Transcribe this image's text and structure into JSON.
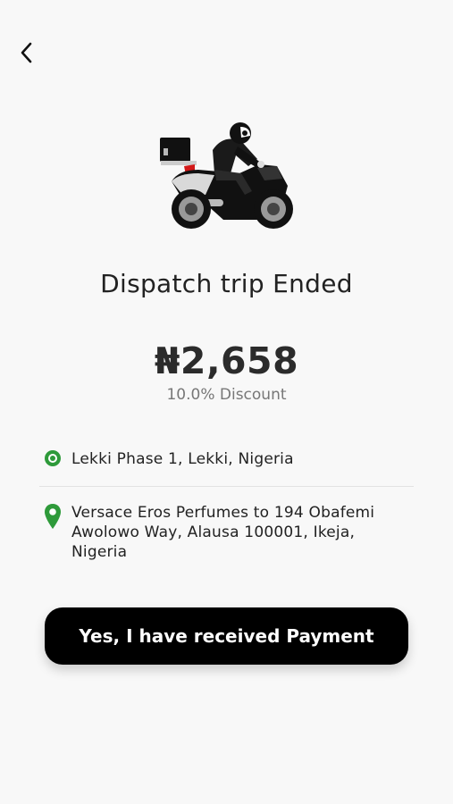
{
  "header": {
    "back_icon": "chevron-left-icon"
  },
  "hero": {
    "illustration": "dispatch-rider-illustration"
  },
  "trip": {
    "status_title": "Dispatch trip Ended",
    "amount": "₦2,658",
    "discount": "10.0% Discount"
  },
  "locations": {
    "pickup": {
      "icon": "pickup-dot-icon",
      "address": "Lekki Phase 1, Lekki, Nigeria"
    },
    "dropoff": {
      "icon": "map-pin-icon",
      "address": "Versace Eros Perfumes to 194 Obafemi Awolowo Way, Alausa 100001, Ikeja, Nigeria"
    }
  },
  "actions": {
    "confirm_label": "Yes, I have received Payment"
  },
  "colors": {
    "accent_green": "#2e9a3a",
    "button_bg": "#000000",
    "button_text": "#ffffff"
  }
}
